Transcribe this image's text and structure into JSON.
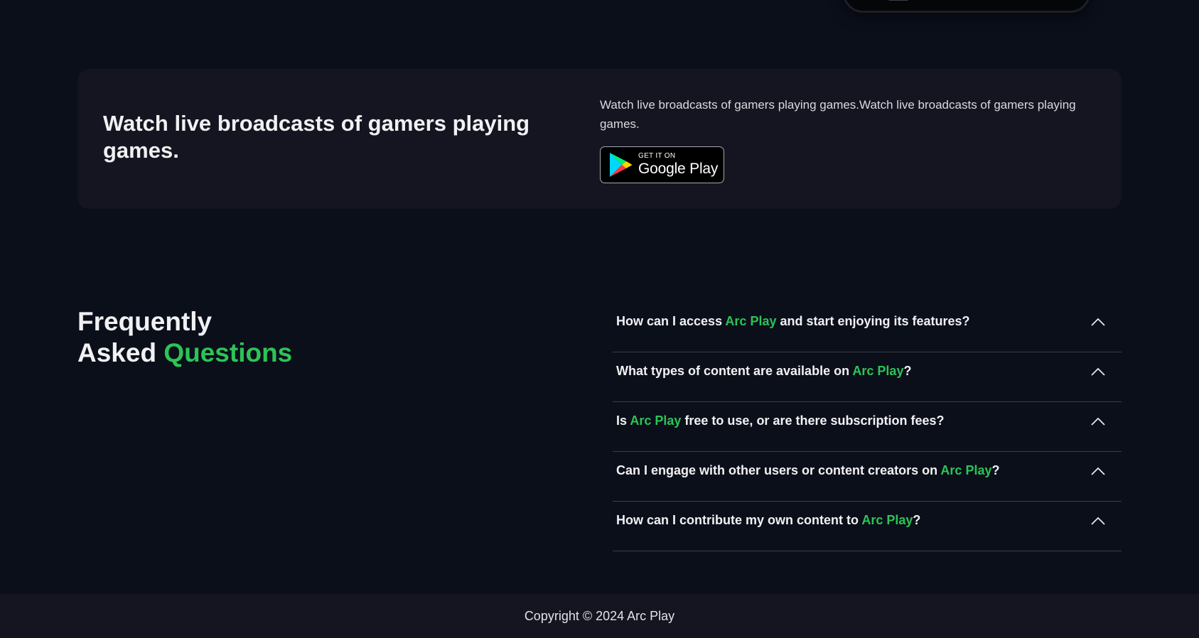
{
  "banner": {
    "title": "Watch live broadcasts of gamers playing games.",
    "description": "Watch live broadcasts of gamers playing games.Watch live broadcasts of gamers playing games.",
    "store_badge": {
      "small_text": "GET IT ON",
      "big_text": "Google Play",
      "icon": "google-play-icon"
    }
  },
  "faq": {
    "heading_line1": "Frequently",
    "heading_line2_a": "Asked ",
    "heading_line2_b": "Questions",
    "items": [
      {
        "pre": "How can I access ",
        "brand": "Arc Play",
        "post": " and start enjoying its features?",
        "icon": "chevron-up-icon"
      },
      {
        "pre": "What types of content are available on ",
        "brand": "Arc Play",
        "post": "?",
        "icon": "chevron-up-icon"
      },
      {
        "pre": "Is ",
        "brand": "Arc Play",
        "post": " free to use, or are there subscription fees?",
        "icon": "chevron-up-icon"
      },
      {
        "pre": "Can I engage with other users or content creators on ",
        "brand": "Arc Play",
        "post": "?",
        "icon": "chevron-up-icon"
      },
      {
        "pre": "How can I contribute my own content to ",
        "brand": "Arc Play",
        "post": "?",
        "icon": "chevron-up-icon"
      }
    ]
  },
  "footer": {
    "copyright": "Copyright © 2024 Arc Play"
  },
  "colors": {
    "background": "#0b0f1a",
    "card": "#141520",
    "accent": "#2cc456"
  }
}
